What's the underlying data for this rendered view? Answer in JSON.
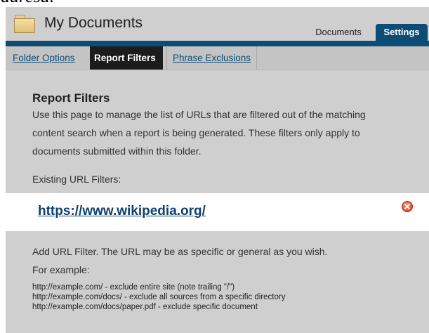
{
  "top_fragment": "adresa.",
  "header": {
    "title": "My Documents",
    "tabs": [
      {
        "label": "Documents",
        "active": false
      },
      {
        "label": "Settings",
        "active": true
      }
    ]
  },
  "subnav": {
    "items": [
      {
        "label": "Folder Options",
        "active": false
      },
      {
        "label": "Report Filters",
        "active": true
      },
      {
        "label": "Phrase Exclusions",
        "active": false
      }
    ]
  },
  "main": {
    "heading": "Report Filters",
    "description": "Use this page to manage the list of URLs that are filtered out of the matching content search when a report is being generated. These filters only apply to documents submitted within this folder.",
    "existing_label": "Existing URL Filters:",
    "filters": [
      {
        "url": "https://www.wikipedia.org/",
        "remove_icon": "remove-icon"
      }
    ],
    "add_text": "Add URL Filter. The URL may be as specific or general as you wish.",
    "example_label": "For example:",
    "examples": [
      "http://example.com/ - exclude entire site (note trailing \"/\")",
      "http://example.com/docs/ - exclude all sources from a specific directory",
      "http://example.com/docs/paper.pdf - exclude specific document"
    ]
  },
  "colors": {
    "accent": "#0d4d75",
    "panel_bg": "#cfcfcf",
    "active_subtab_bg": "#1c1c1c",
    "link": "#0e3f6b"
  }
}
